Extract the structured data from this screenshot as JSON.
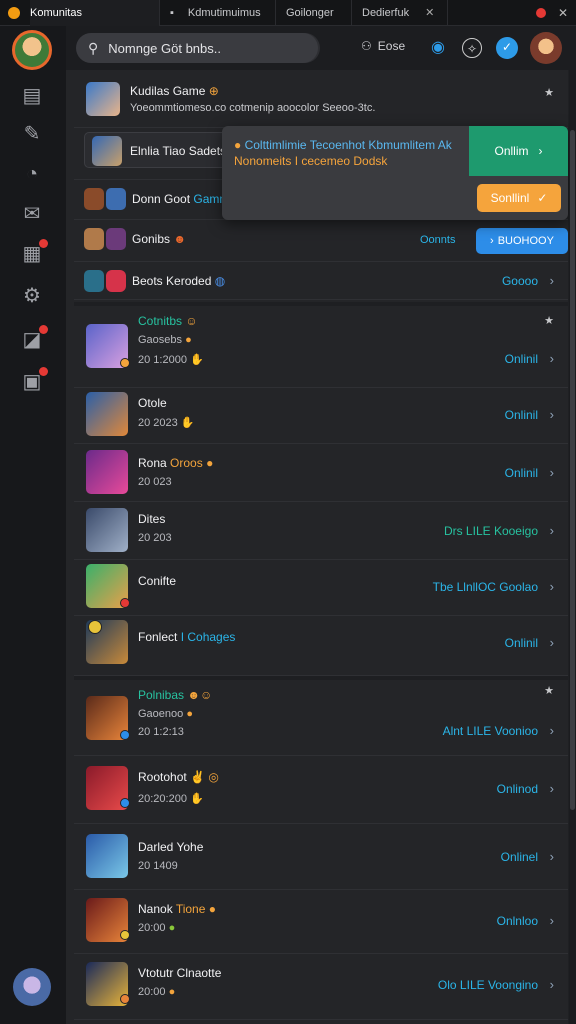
{
  "window": {
    "app_title": "Komunitas",
    "tabs": [
      "Komunitas",
      "Kdmutimuimus",
      "Goilonger",
      "Dedierfuk"
    ]
  },
  "header": {
    "search_placeholder": "Nomnge Göt bnbs..",
    "user_label": "Eose"
  },
  "popup": {
    "title": "Colttimlimie Tecoenhot Kbmumlitem Ak",
    "subtitle": "Nonomeits I cecemeo Dodsk",
    "primary_button": "Onllim",
    "secondary_button": "Sonllinl"
  },
  "top_rows": [
    {
      "title": "Kudilas Game",
      "subtitle": "Yoeommtiomeso.co cotmenip aoocolor Seeoo-3tc."
    },
    {
      "title": "Elnlia Tiao Sadets"
    },
    {
      "title": "Donn Goot",
      "title_accent": "Gamm"
    },
    {
      "title": "Gonibs",
      "status": "Oonnts",
      "button": "BUOHOOY"
    },
    {
      "title": "Beots Keroded",
      "status": "Goooo"
    }
  ],
  "rows": [
    {
      "title": "Cotnitbs",
      "sub1": "Gaosebs",
      "sub2": "20 1:2000",
      "status": "Onlinil"
    },
    {
      "title": "Otole",
      "sub1": "20 2023",
      "status": "Onlinil"
    },
    {
      "title": "Rona",
      "title_accent": "Oroos",
      "sub1": "20 023",
      "status": "Onlinil"
    },
    {
      "title": "Dites",
      "sub1": "20 203",
      "status": "Drs LILE Kooeigo"
    },
    {
      "title": "Conifte",
      "status": "Tbe LlnllOC Goolao"
    },
    {
      "title": "Fonlect",
      "title_accent": "I Cohages",
      "status": "Onlinil"
    },
    {
      "title": "Polnibas",
      "sub1": "Gaoenoo",
      "sub2": "20 1:2:13",
      "status": "Alnt LILE Voonioo"
    },
    {
      "title": "Rootohot",
      "sub1": "20:20:200",
      "status": "Onlinod"
    },
    {
      "title": "Darled Yohe",
      "sub1": "20 1409",
      "status": "Onlinel"
    },
    {
      "title": "Nanok",
      "title_accent": "Tione",
      "sub1": "20:00",
      "status": "Onlnloo"
    },
    {
      "title": "Vtotutr Clnaotte",
      "sub1": "20:00",
      "status": "Olo LILE Voongino"
    }
  ]
}
